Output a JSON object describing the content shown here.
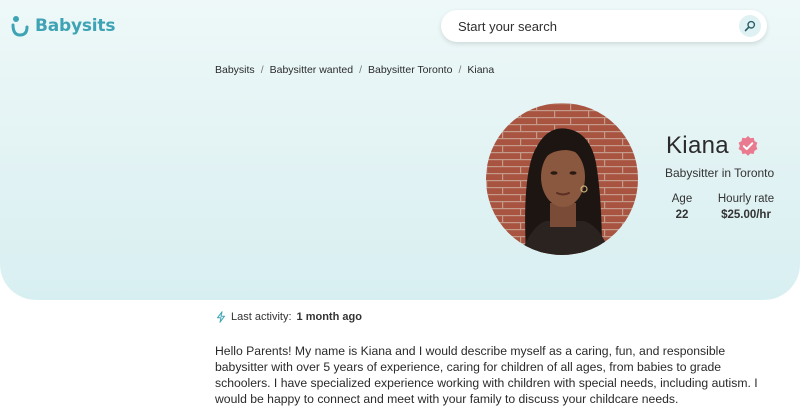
{
  "brand": {
    "name": "Babysits",
    "color": "#3ea3b4"
  },
  "search": {
    "placeholder": "Start your search",
    "icon": "search-icon"
  },
  "breadcrumb": [
    "Babysits",
    "Babysitter wanted",
    "Babysitter Toronto",
    "Kiana"
  ],
  "profile": {
    "name": "Kiana",
    "verified_icon": "verified-check-icon",
    "subtitle": "Babysitter in Toronto",
    "stats": [
      {
        "label": "Age",
        "value": "22"
      },
      {
        "label": "Hourly rate",
        "value": "$25.00/hr"
      }
    ]
  },
  "activity": {
    "label": "Last activity:",
    "value": "1 month ago",
    "icon": "lightning-icon"
  },
  "bio": "Hello Parents! My name is Kiana and I would describe myself as a caring, fun, and responsible babysitter with over 5 years of experience, caring for children of all ages, from babies to grade schoolers. I have specialized experience working with children with special needs, including autism. I would be happy to connect and meet with your family to discuss your childcare needs.",
  "colors": {
    "hero_bg": "#e3f3f4",
    "verified": "#e97a8f",
    "accent": "#3ea3b4"
  }
}
